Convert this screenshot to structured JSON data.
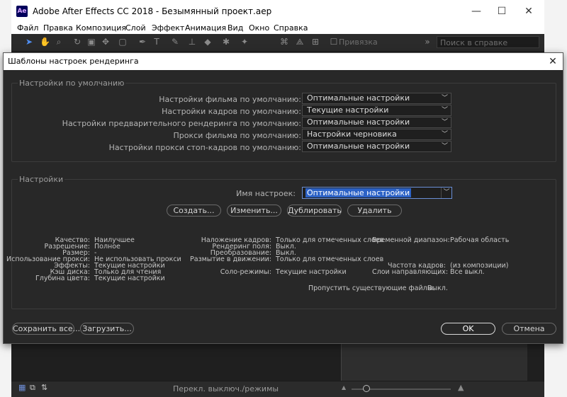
{
  "app": {
    "title": "Adobe After Effects CC 2018 - Безымянный проект.aep",
    "logo": "Ae",
    "window_controls": {
      "minimize": "—",
      "maximize": "☐",
      "close": "✕"
    }
  },
  "menu": [
    "Файл",
    "Правка",
    "Композиция",
    "Слой",
    "Эффект",
    "Анимация",
    "Вид",
    "Окно",
    "Справка"
  ],
  "toolbar": {
    "snap_label": "Привязка",
    "search_placeholder": "Поиск в справке"
  },
  "status": {
    "text": "Перекл. выключ./режимы"
  },
  "dialog": {
    "title": "Шаблоны настроек рендеринга",
    "close": "✕",
    "defaults_group": {
      "title": "Настройки по умолчанию",
      "rows": [
        {
          "label": "Настройки фильма по умолчанию:",
          "value": "Оптимальные настройки"
        },
        {
          "label": "Настройки кадров по умолчанию:",
          "value": "Текущие настройки"
        },
        {
          "label": "Настройки предварительного рендеринга по умолчанию:",
          "value": "Оптимальные настройки"
        },
        {
          "label": "Прокси фильма по умолчанию:",
          "value": "Настройки черновика"
        },
        {
          "label": "Настройки прокси стоп-кадров по умолчанию:",
          "value": "Оптимальные настройки"
        }
      ]
    },
    "settings_group": {
      "title": "Настройки",
      "preset_name_label": "Имя настроек:",
      "preset_name_value": "Оптимальные настройки",
      "buttons": {
        "create": "Создать...",
        "edit": "Изменить...",
        "duplicate": "Дублировать",
        "delete": "Удалить"
      },
      "info_col1": [
        {
          "k": "Качество:",
          "v": "Наилучшее"
        },
        {
          "k": "Разрешение:",
          "v": "Полное"
        },
        {
          "k": "Размер:",
          "v": "-"
        },
        {
          "k": "Использование прокси:",
          "v": "Не использовать прокси"
        },
        {
          "k": "Эффекты:",
          "v": "Текущие  настройки"
        },
        {
          "k": "Кэш диска:",
          "v": "Только для чтения"
        },
        {
          "k": "Глубина цвета:",
          "v": "Текущие настройки"
        }
      ],
      "info_col2": [
        {
          "k": "Наложение кадров:",
          "v": "Только для отмеченных слоев"
        },
        {
          "k": "Рендеринг поля:",
          "v": "Выкл."
        },
        {
          "k": "Преобразование:",
          "v": "Выкл."
        },
        {
          "k": "Размытие в движении:",
          "v": "Только для отмеченных слоев"
        },
        {
          "k": "Соло-режимы:",
          "v": "Текущие  настройки"
        }
      ],
      "info_col3": [
        {
          "k": "Временной диапазон:",
          "v": "Рабочая область"
        },
        {
          "k": "Частота кадров:",
          "v": "(из композиции)"
        },
        {
          "k": "Слои направляющих:",
          "v": "Все выкл."
        }
      ],
      "skip_files": {
        "k": "Пропустить существующие файлы:",
        "v": "Выкл."
      }
    },
    "footer": {
      "save": "Сохранить все...",
      "load": "Загрузить...",
      "ok": "OK",
      "cancel": "Отмена"
    }
  }
}
